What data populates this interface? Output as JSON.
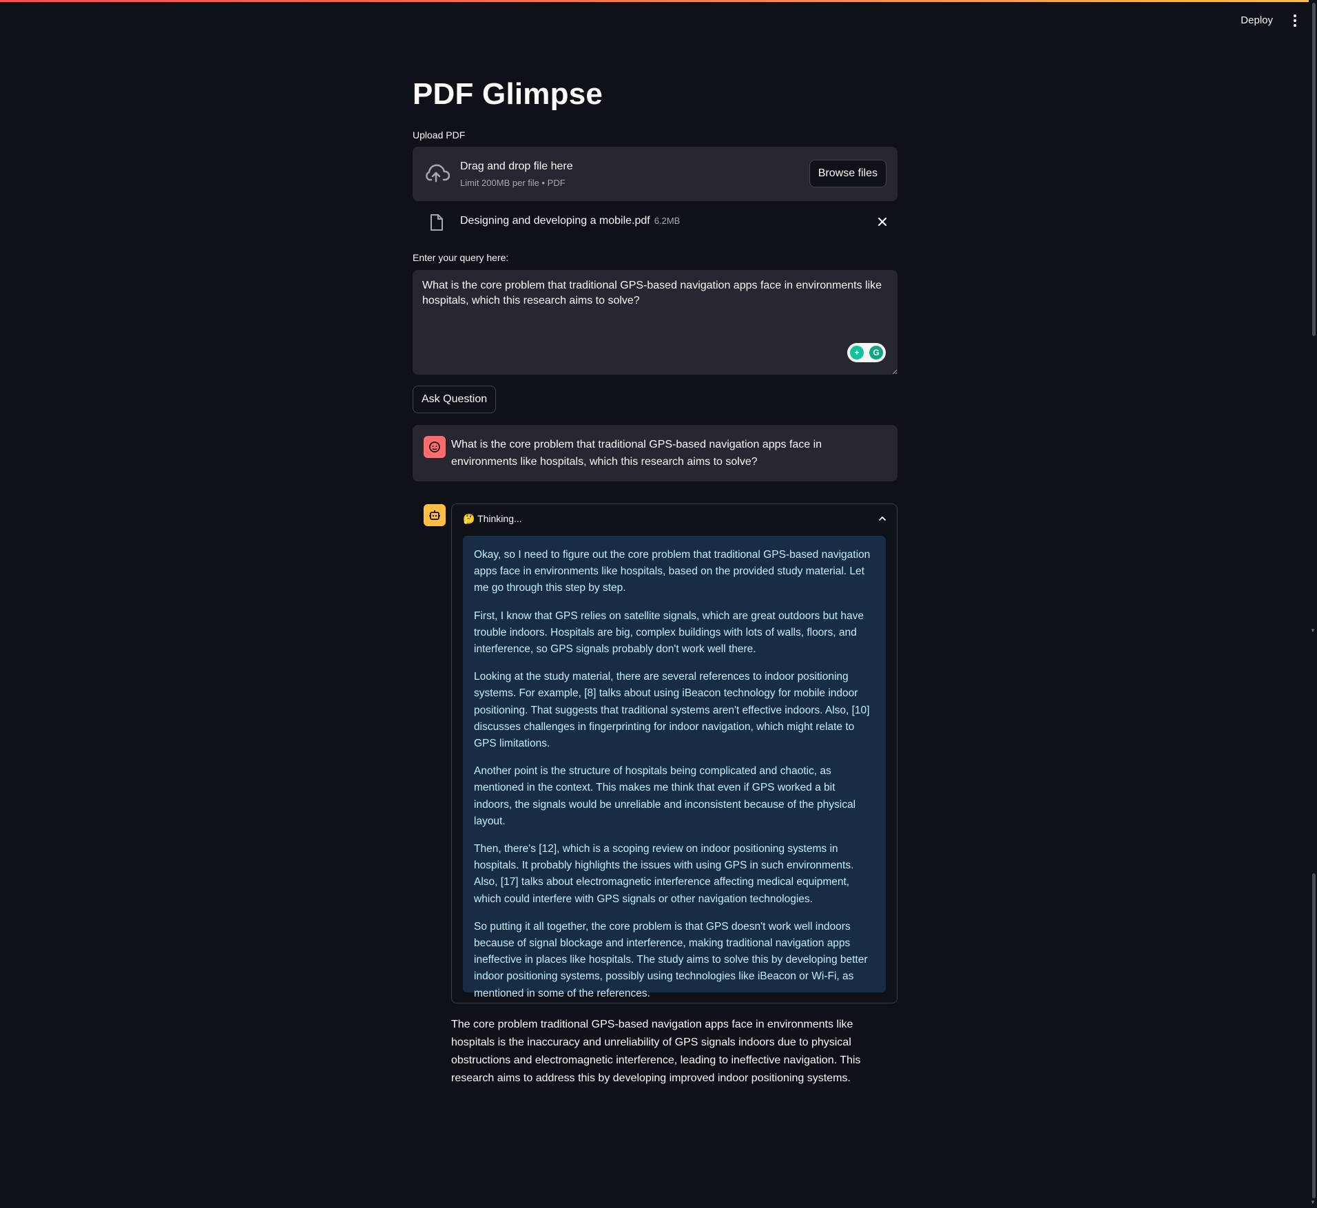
{
  "header": {
    "deploy_label": "Deploy"
  },
  "page": {
    "title": "PDF Glimpse"
  },
  "uploader": {
    "label": "Upload PDF",
    "drop_title": "Drag and drop file here",
    "drop_subtitle": "Limit 200MB per file • PDF",
    "browse_label": "Browse files",
    "file": {
      "name": "Designing and developing a mobile.pdf",
      "size": "6.2MB"
    }
  },
  "query": {
    "label": "Enter your query here:",
    "value": "What is the core problem that traditional GPS-based navigation apps face in environments like hospitals, which this research aims to solve?",
    "ask_label": "Ask Question"
  },
  "chat": {
    "user_message": "What is the core problem that traditional GPS-based navigation apps face in environments like hospitals, which this research aims to solve?",
    "thinking_label": "🤔 Thinking...",
    "thinking_paragraphs": [
      "Okay, so I need to figure out the core problem that traditional GPS-based navigation apps face in environments like hospitals, based on the provided study material. Let me go through this step by step.",
      "First, I know that GPS relies on satellite signals, which are great outdoors but have trouble indoors. Hospitals are big, complex buildings with lots of walls, floors, and interference, so GPS signals probably don't work well there.",
      "Looking at the study material, there are several references to indoor positioning systems. For example, [8] talks about using iBeacon technology for mobile indoor positioning. That suggests that traditional systems aren't effective indoors. Also, [10] discusses challenges in fingerprinting for indoor navigation, which might relate to GPS limitations.",
      "Another point is the structure of hospitals being complicated and chaotic, as mentioned in the context. This makes me think that even if GPS worked a bit indoors, the signals would be unreliable and inconsistent because of the physical layout.",
      "Then, there's [12], which is a scoping review on indoor positioning systems in hospitals. It probably highlights the issues with using GPS in such environments. Also, [17] talks about electromagnetic interference affecting medical equipment, which could interfere with GPS signals or other navigation technologies.",
      "So putting it all together, the core problem is that GPS doesn't work well indoors because of signal blockage and interference, making traditional navigation apps ineffective in places like hospitals. The study aims to solve this by developing better indoor positioning systems, possibly using technologies like iBeacon or Wi-Fi, as mentioned in some of the references."
    ],
    "answer": "The core problem traditional GPS-based navigation apps face in environments like hospitals is the inaccuracy and unreliability of GPS signals indoors due to physical obstructions and electromagnetic interference, leading to ineffective navigation. This research aims to address this by developing improved indoor positioning systems."
  },
  "colors": {
    "background": "#0e1117",
    "surface": "#262730",
    "user_avatar": "#ff6c6c",
    "bot_avatar": "#ffbd45",
    "thinking_bg": "#172d43",
    "thinking_text": "#c7ebff"
  },
  "icons": {
    "upload": "cloud-upload-icon",
    "file": "file-icon",
    "close": "close-icon",
    "user": "user-face-icon",
    "bot": "robot-icon",
    "collapse": "chevron-up-icon",
    "menu": "kebab-menu-icon"
  }
}
